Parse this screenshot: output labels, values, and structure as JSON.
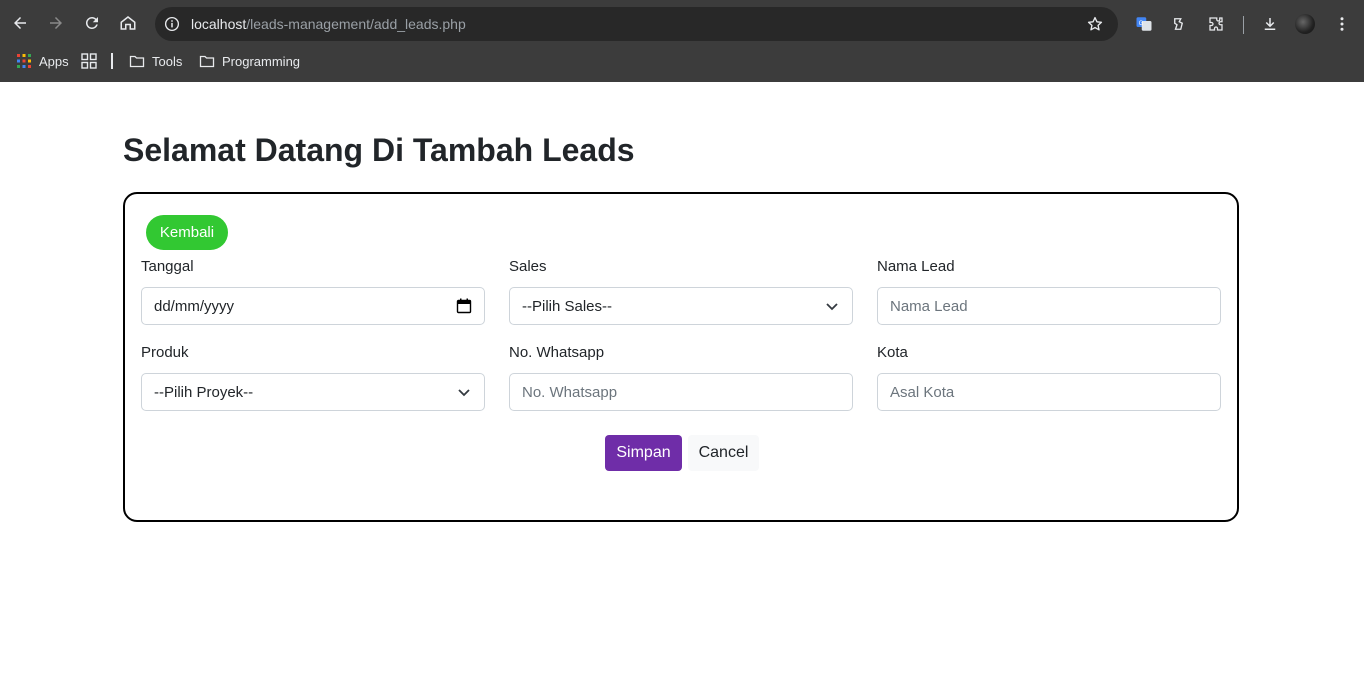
{
  "browser": {
    "url_host": "localhost",
    "url_path": "/leads-management/add_leads.php",
    "bookmarks": [
      {
        "label": "Apps"
      },
      {
        "label": "Tools"
      },
      {
        "label": "Programming"
      }
    ]
  },
  "page": {
    "title": "Selamat Datang Di Tambah Leads",
    "back_label": "Kembali",
    "fields": {
      "tanggal": {
        "label": "Tanggal",
        "value": "dd/mm/yyyy"
      },
      "sales": {
        "label": "Sales",
        "value": "--Pilih Sales--"
      },
      "nama_lead": {
        "label": "Nama Lead",
        "placeholder": "Nama Lead"
      },
      "produk": {
        "label": "Produk",
        "value": "--Pilih Proyek--"
      },
      "whatsapp": {
        "label": "No. Whatsapp",
        "placeholder": "No. Whatsapp"
      },
      "kota": {
        "label": "Kota",
        "placeholder": "Asal Kota"
      }
    },
    "save_label": "Simpan",
    "cancel_label": "Cancel"
  },
  "colors": {
    "back_button": "#32c832",
    "save_button": "#6f2da8",
    "chrome_bg": "#3c3c3c"
  }
}
